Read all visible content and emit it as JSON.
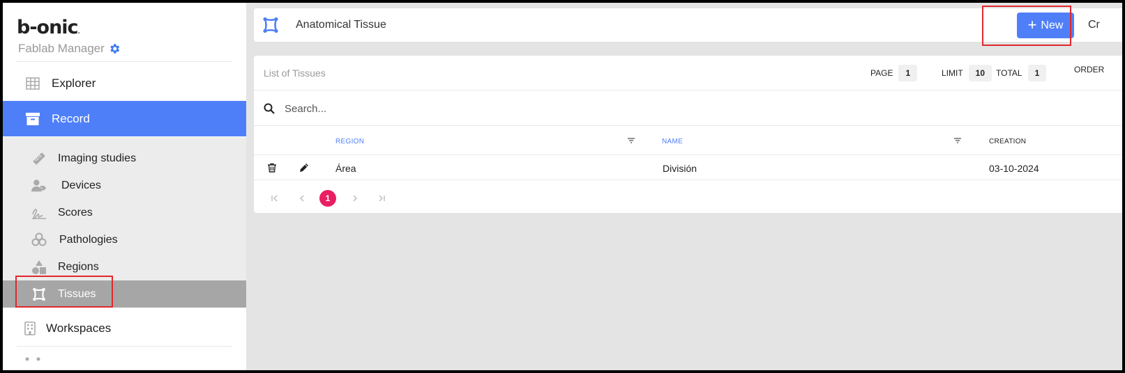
{
  "brand": {
    "logo": "b-onic",
    "logo_mark": ".",
    "subtitle": "Fablab Manager"
  },
  "sidebar": {
    "main_items": [
      {
        "label": "Explorer",
        "icon": "grid-icon"
      },
      {
        "label": "Record",
        "icon": "archive-icon",
        "active": true
      }
    ],
    "sub_items": [
      {
        "label": "Imaging studies",
        "icon": "ruler-icon"
      },
      {
        "label": "Devices",
        "icon": "user-tag-icon"
      },
      {
        "label": "Scores",
        "icon": "signature-icon"
      },
      {
        "label": "Pathologies",
        "icon": "biohazard-icon"
      },
      {
        "label": "Regions",
        "icon": "shapes-icon"
      },
      {
        "label": "Tissues",
        "icon": "tissue-icon",
        "selected": true
      }
    ],
    "bottom_items": [
      {
        "label": "Workspaces",
        "icon": "building-icon"
      }
    ]
  },
  "header": {
    "title": "Anatomical Tissue",
    "new_label": "New",
    "cut_label": "Cr"
  },
  "list": {
    "title": "List of Tissues",
    "page_label": "PAGE",
    "page_value": "1",
    "limit_label": "LIMIT",
    "limit_value": "10",
    "total_label": "TOTAL",
    "total_value": "1",
    "order_label": "ORDER",
    "search_placeholder": "Search...",
    "columns": [
      "REGION",
      "NAME",
      "CREATION"
    ],
    "rows": [
      {
        "region": "Área",
        "name": "División",
        "creation": "03-10-2024"
      }
    ],
    "pagination": {
      "current": "1",
      "first": "|<",
      "prev": "<",
      "next": ">",
      "last": ">|"
    }
  },
  "colors": {
    "accent": "#4f7ff8",
    "page_current": "#e91e63",
    "highlight_box": "#e0282e"
  }
}
